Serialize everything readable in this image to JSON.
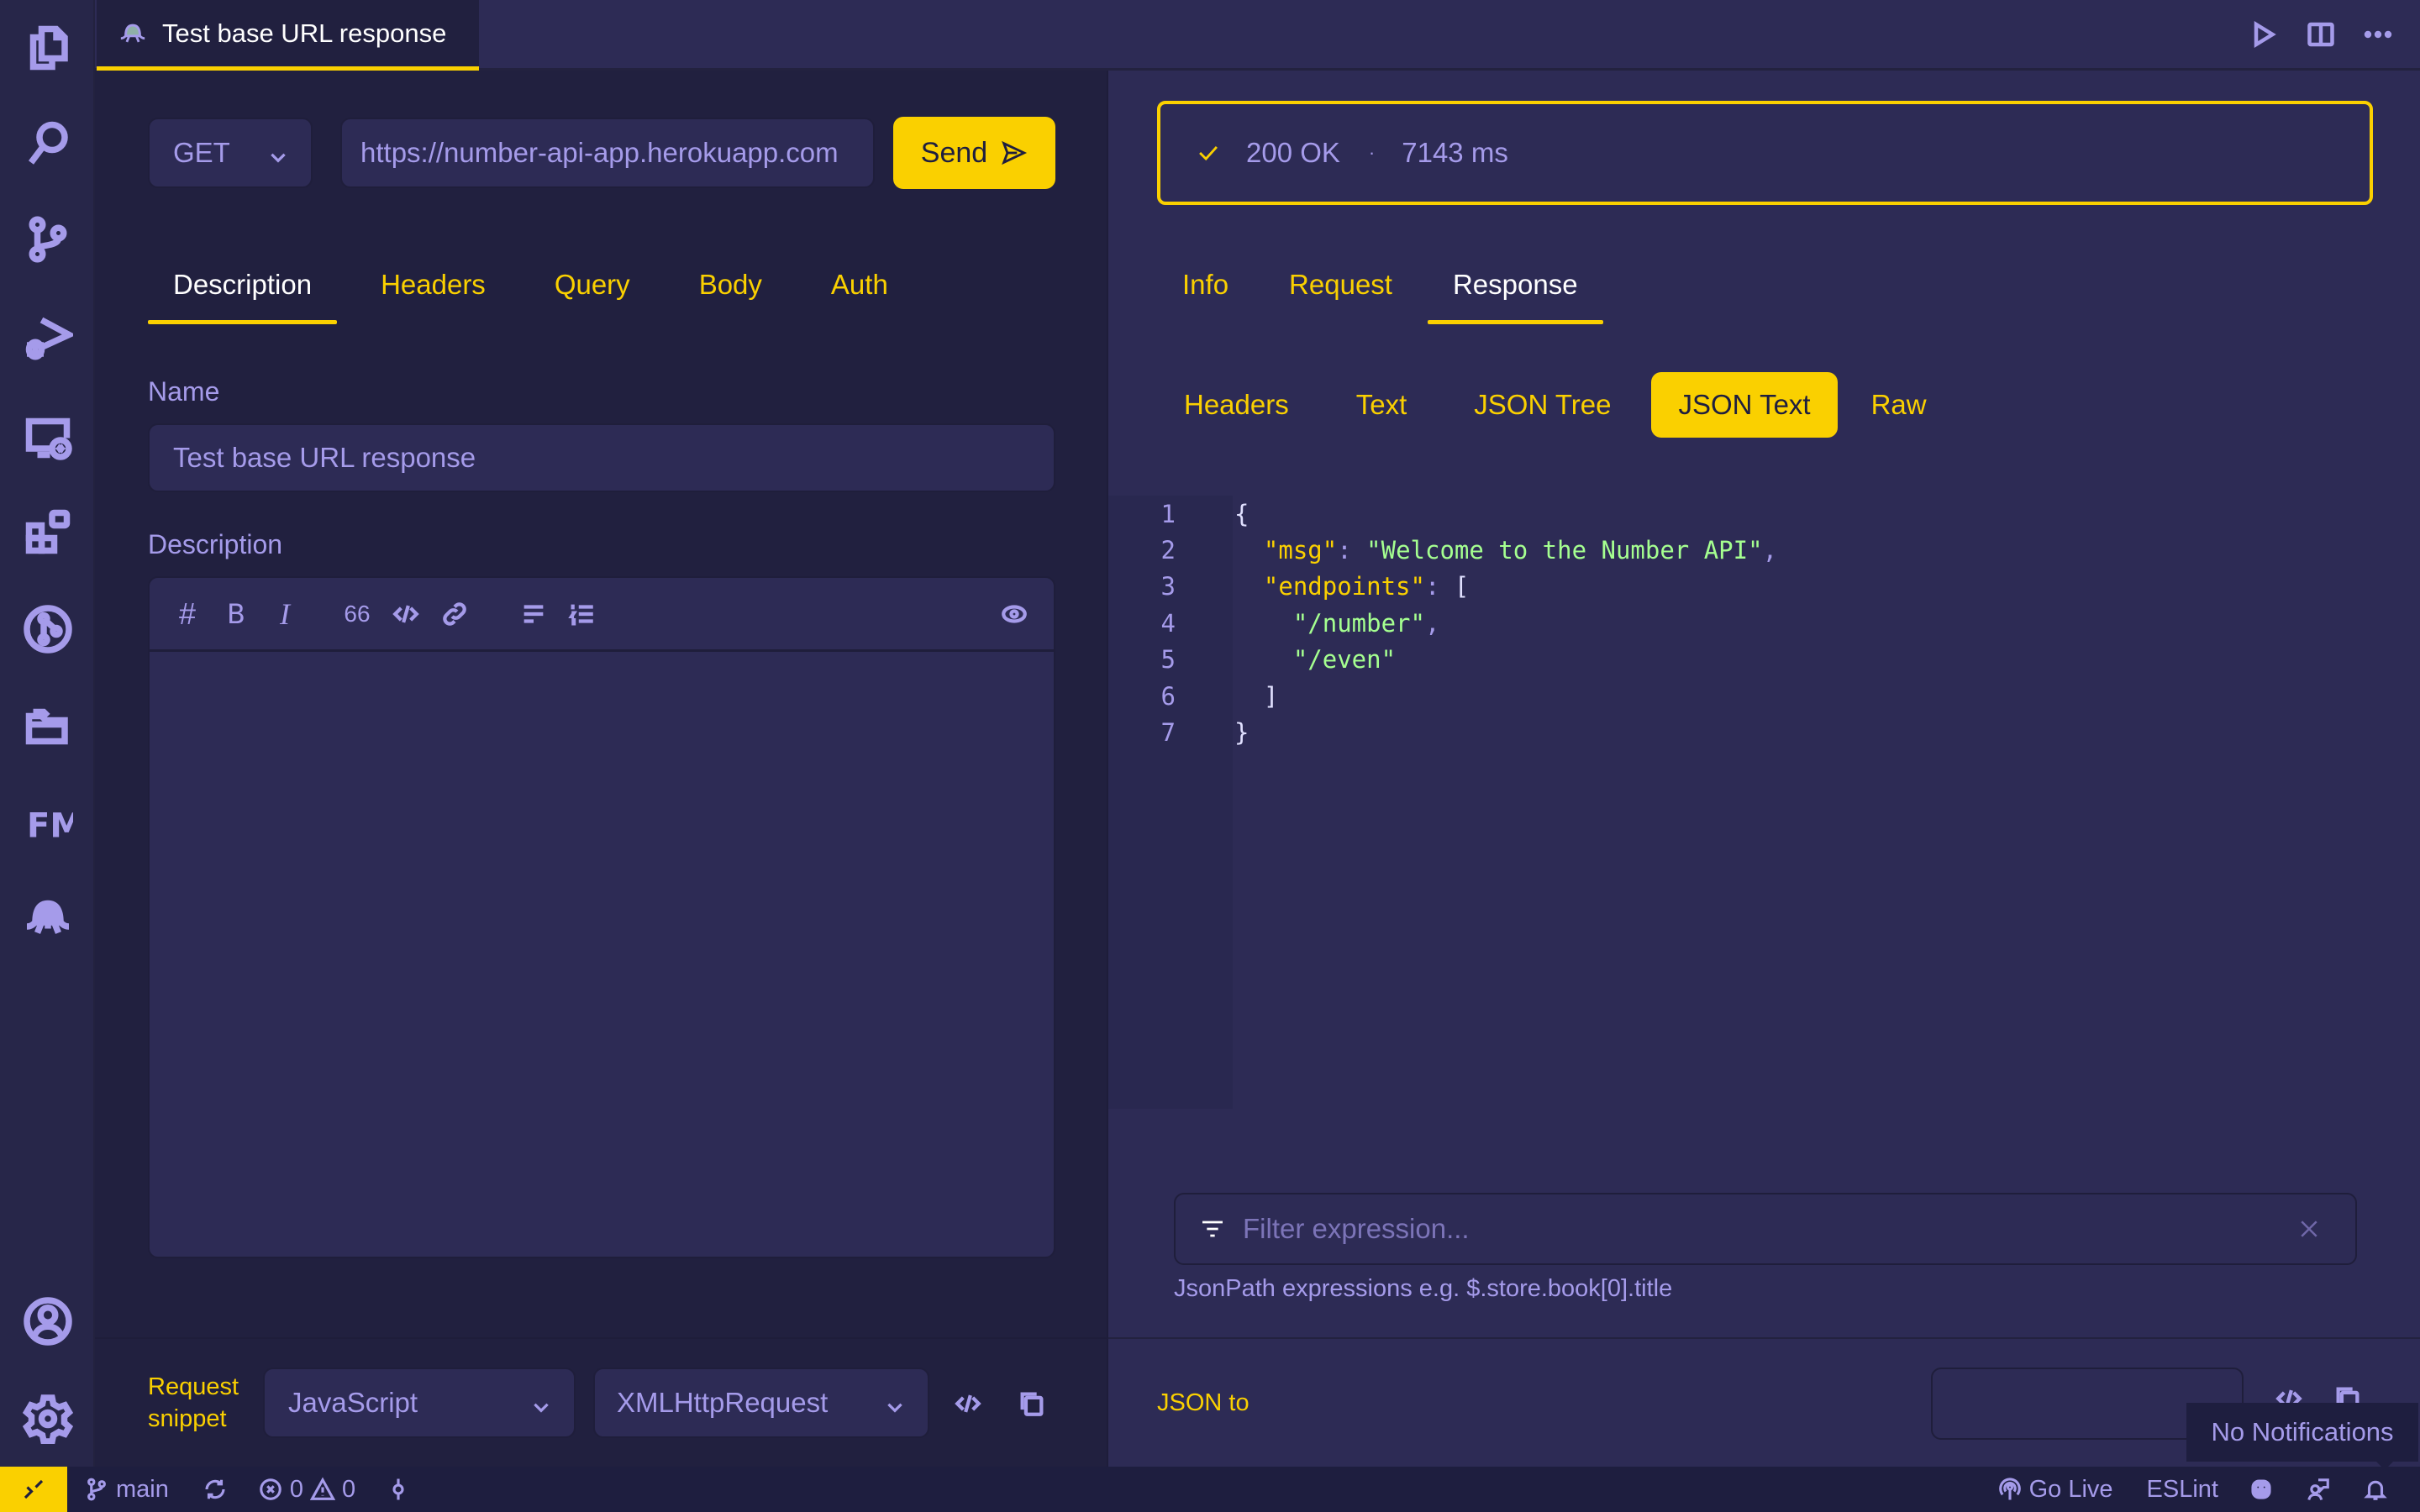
{
  "activity_bar": {
    "items": [
      {
        "name": "explorer",
        "icon": "files-icon"
      },
      {
        "name": "search",
        "icon": "search-icon"
      },
      {
        "name": "source-control",
        "icon": "source-control-icon"
      },
      {
        "name": "run-debug",
        "icon": "run-debug-icon"
      },
      {
        "name": "remote-explorer",
        "icon": "remote-explorer-icon"
      },
      {
        "name": "extensions",
        "icon": "extensions-icon"
      },
      {
        "name": "gitlens",
        "icon": "gitlens-icon"
      },
      {
        "name": "file-manager",
        "icon": "folders-icon"
      },
      {
        "name": "fm",
        "icon": "fm-icon",
        "label": "FM"
      },
      {
        "name": "thunder-client",
        "icon": "octopus-icon"
      }
    ],
    "bottom": [
      {
        "name": "accounts",
        "icon": "account-icon"
      },
      {
        "name": "settings",
        "icon": "gear-icon"
      }
    ]
  },
  "editor_tab": {
    "title": "Test base URL response",
    "icon": "octopus-icon"
  },
  "tab_actions": [
    "run-icon",
    "split-editor-icon",
    "more-icon"
  ],
  "request": {
    "method": "GET",
    "url": "https://number-api-app.herokuapp.com",
    "send_label": "Send",
    "tabs": [
      {
        "label": "Description",
        "active": true
      },
      {
        "label": "Headers",
        "active": false
      },
      {
        "label": "Query",
        "active": false
      },
      {
        "label": "Body",
        "active": false
      },
      {
        "label": "Auth",
        "active": false
      }
    ],
    "name_label": "Name",
    "name_value": "Test base URL response",
    "description_label": "Description",
    "description_value": "",
    "toolbar": [
      "heading-icon",
      "bold-icon",
      "italic-icon",
      "quote-icon",
      "code-icon",
      "link-icon",
      "bullet-list-icon",
      "numbered-list-icon",
      "preview-icon"
    ],
    "toolbar_text": {
      "heading": "#",
      "bold": "B",
      "italic": "I",
      "quote": "66"
    },
    "snippet_label_1": "Request",
    "snippet_label_2": "snippet",
    "snippet_language": "JavaScript",
    "snippet_library": "XMLHttpRequest"
  },
  "response": {
    "status": "200 OK",
    "separator": "·",
    "time": "7143 ms",
    "tabs": [
      {
        "label": "Info",
        "active": false
      },
      {
        "label": "Request",
        "active": false
      },
      {
        "label": "Response",
        "active": true
      }
    ],
    "subtabs": [
      {
        "label": "Headers",
        "active": false
      },
      {
        "label": "Text",
        "active": false
      },
      {
        "label": "JSON Tree",
        "active": false
      },
      {
        "label": "JSON Text",
        "active": true
      },
      {
        "label": "Raw",
        "active": false
      }
    ],
    "code_lines": [
      {
        "n": "1",
        "parts": [
          [
            "w",
            "{"
          ]
        ]
      },
      {
        "n": "2",
        "parts": [
          [
            "w",
            "  "
          ],
          [
            "k",
            "\"msg\""
          ],
          [
            "p",
            ": "
          ],
          [
            "s",
            "\"Welcome to the Number API\""
          ],
          [
            "p",
            ","
          ]
        ]
      },
      {
        "n": "3",
        "parts": [
          [
            "w",
            "  "
          ],
          [
            "k",
            "\"endpoints\""
          ],
          [
            "p",
            ": "
          ],
          [
            "w",
            "["
          ]
        ]
      },
      {
        "n": "4",
        "parts": [
          [
            "w",
            "    "
          ],
          [
            "s",
            "\"/number\""
          ],
          [
            "p",
            ","
          ]
        ]
      },
      {
        "n": "5",
        "parts": [
          [
            "w",
            "    "
          ],
          [
            "s",
            "\"/even\""
          ]
        ]
      },
      {
        "n": "6",
        "parts": [
          [
            "w",
            "  ]"
          ]
        ]
      },
      {
        "n": "7",
        "parts": [
          [
            "w",
            "}"
          ]
        ]
      }
    ],
    "filter_placeholder": "Filter expression...",
    "filter_hint": "JsonPath expressions e.g. $.store.book[0].title",
    "json_to_label": "JSON to",
    "json_to_value": ""
  },
  "status_bar": {
    "branch": "main",
    "errors": "0",
    "warnings": "0",
    "go_live": "Go Live",
    "eslint": "ESLint"
  },
  "notification_toast": "No Notifications",
  "colors": {
    "accent": "#fad000",
    "fg": "#a59bea",
    "bg_dark": "#21203f",
    "bg_panel": "#2d2b55",
    "string": "#a5ff90"
  }
}
